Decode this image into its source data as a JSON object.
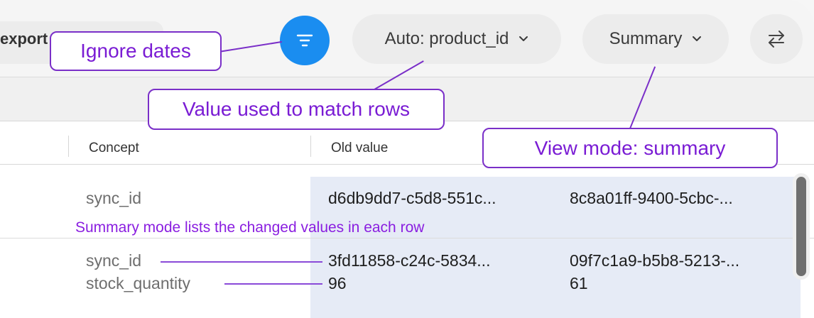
{
  "toolbar": {
    "export_label": "export",
    "match_label": "Auto: product_id",
    "view_label": "Summary"
  },
  "table": {
    "headers": {
      "concept": "Concept",
      "old_value": "Old value"
    },
    "rows": [
      {
        "entries": [
          {
            "concept": "sync_id",
            "old": "d6db9dd7-c5d8-551c...",
            "new": "8c8a01ff-9400-5cbc-..."
          }
        ]
      },
      {
        "entries": [
          {
            "concept": "sync_id",
            "old": "3fd11858-c24c-5834...",
            "new": "09f7c1a9-b5b8-5213-..."
          },
          {
            "concept": "stock_quantity",
            "old": "96",
            "new": "61"
          }
        ]
      }
    ]
  },
  "annotations": {
    "ignore_dates": "Ignore dates",
    "match_rows": "Value used to match rows",
    "view_mode": "View mode: summary",
    "summary_note": "Summary mode lists the changed values in each row"
  },
  "colors": {
    "accent": "#1a8df0",
    "annotation": "#7a2fc8",
    "highlight": "#e6ebf6"
  }
}
